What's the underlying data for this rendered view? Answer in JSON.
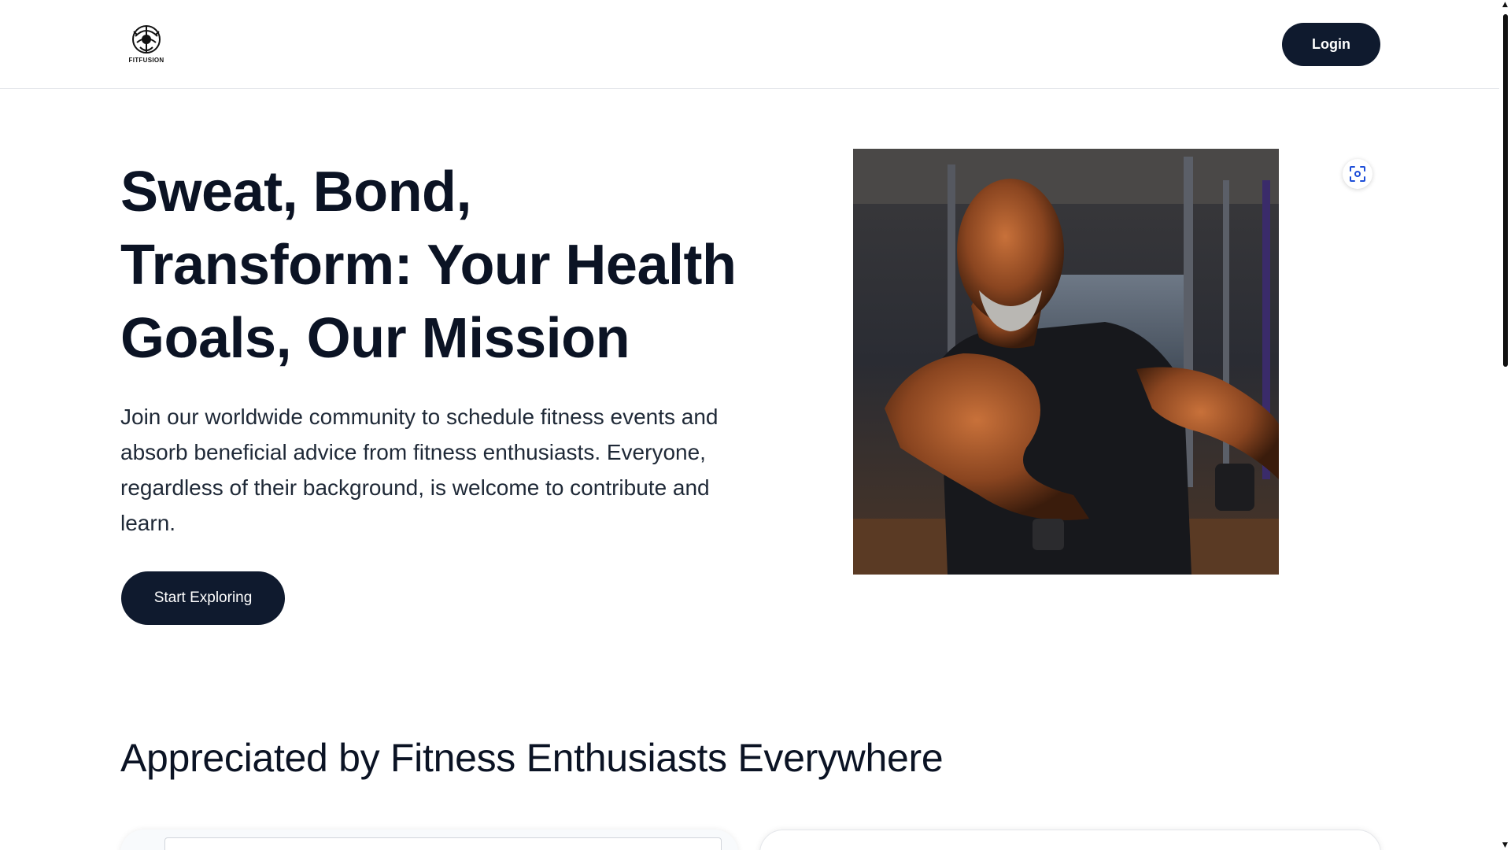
{
  "header": {
    "logo_text": "FITFUSION",
    "login_label": "Login"
  },
  "hero": {
    "title": "Sweat, Bond, Transform: Your Health Goals, Our Mission",
    "description": "Join our worldwide community to schedule fitness events and absorb beneficial advice from fitness enthusiasts. Everyone, regardless of their background, is welcome to contribute and learn.",
    "cta_label": "Start Exploring",
    "image_icon": "scan-icon"
  },
  "testimonials": {
    "title": "Appreciated by Fitness Enthusiasts Everywhere"
  },
  "colors": {
    "primary": "#0f1a2e",
    "heading": "#0b1324",
    "text": "#1f2937",
    "border": "#e5e7eb"
  }
}
